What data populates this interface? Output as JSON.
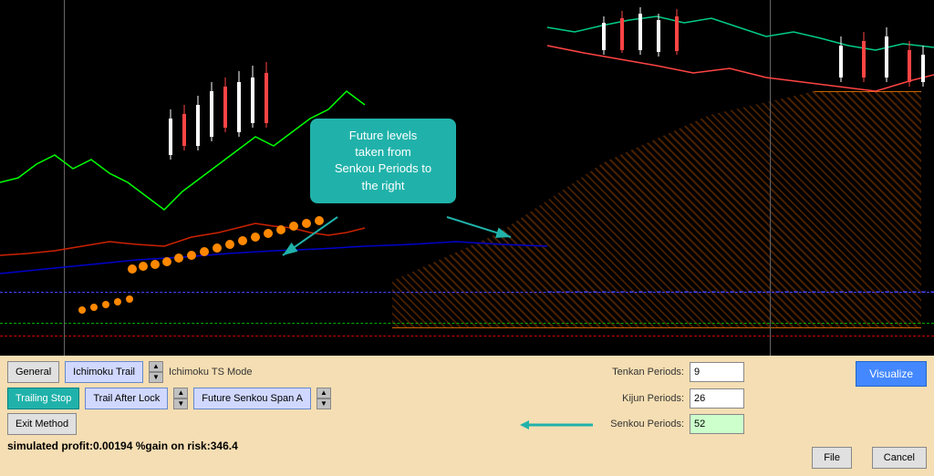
{
  "chart": {
    "tooltip": {
      "line1": "Future levels",
      "line2": "taken from",
      "line3": "Senkou Periods to",
      "line4": "the right"
    }
  },
  "controls": {
    "row1": {
      "btn_general": "General",
      "btn_ichimoku": "Ichimoku Trail",
      "mode_label": "Ichimoku TS Mode"
    },
    "row2": {
      "btn_trailing": "Trailing Stop",
      "btn_trail_after": "Trail After Lock",
      "btn_future_senkou": "Future Senkou Span A"
    },
    "row3": {
      "btn_exit": "Exit Method"
    },
    "periods": {
      "tenkan_label": "Tenkan Periods:",
      "tenkan_value": "9",
      "kijun_label": "Kijun Periods:",
      "kijun_value": "26",
      "senkou_label": "Senkou Periods:",
      "senkou_value": "52"
    },
    "buttons": {
      "visualize": "Visualize",
      "file": "File",
      "cancel": "Cancel"
    },
    "status": "simulated profit:0.00194  %gain on risk:346.4"
  }
}
